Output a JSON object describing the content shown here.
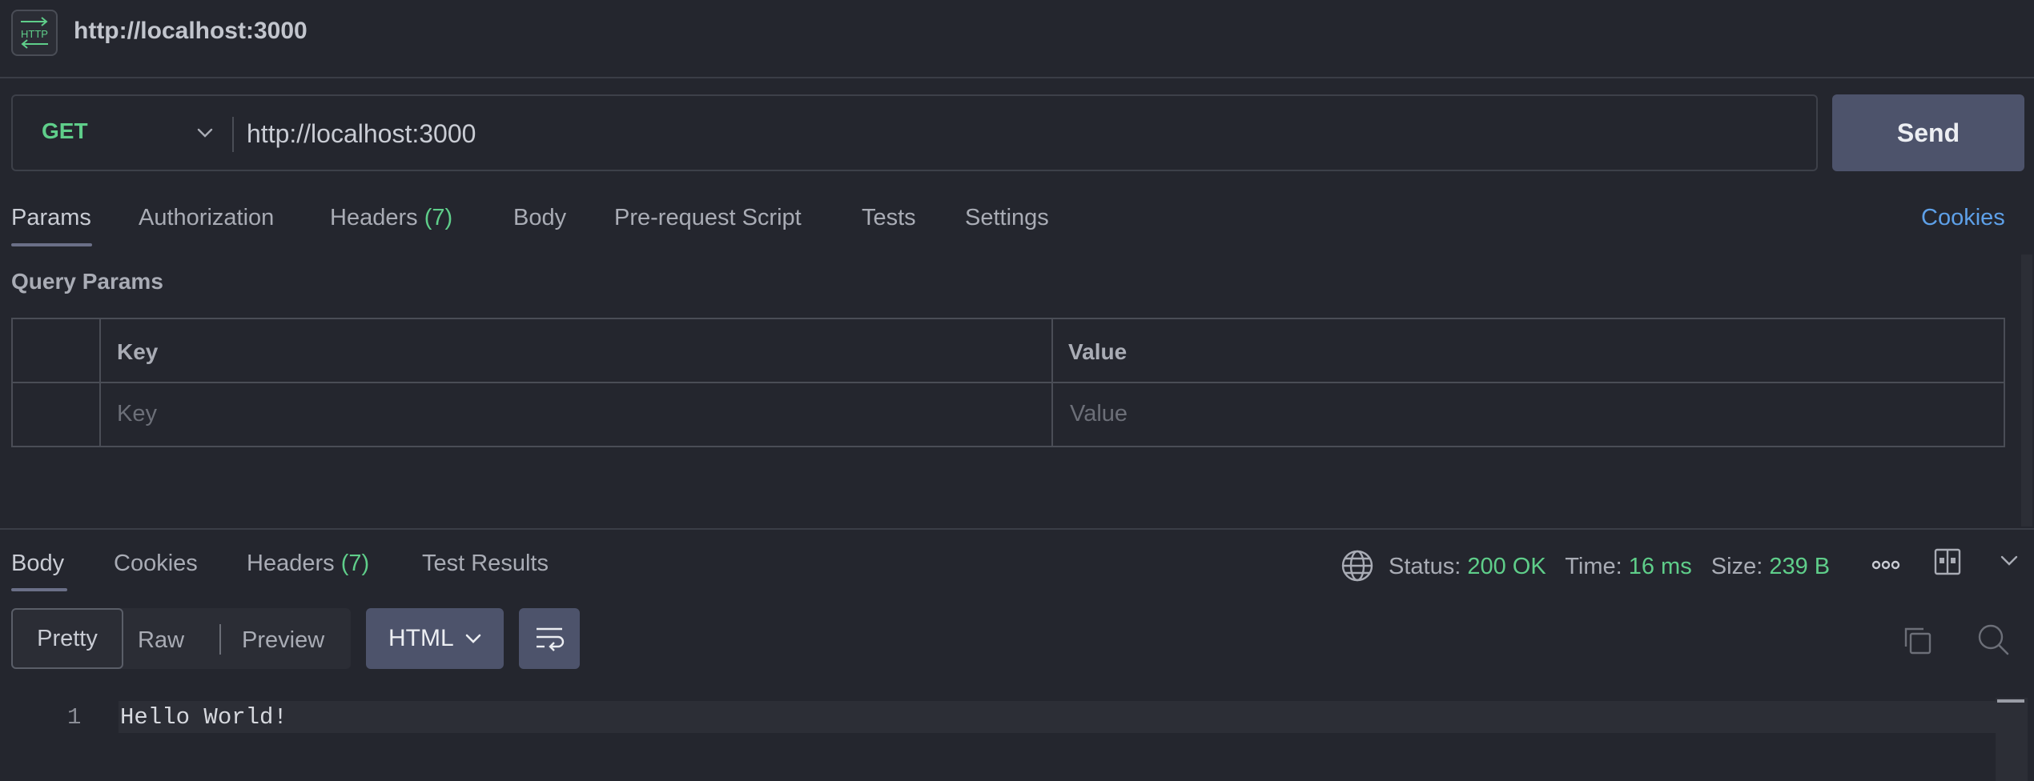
{
  "topbar": {
    "badge_text": "HTTP",
    "title": "http://localhost:3000"
  },
  "request": {
    "method": "GET",
    "url": "http://localhost:3000",
    "send_label": "Send"
  },
  "request_tabs": {
    "params": "Params",
    "authorization": "Authorization",
    "headers": "Headers",
    "headers_count": "(7)",
    "body": "Body",
    "prerequest": "Pre-request Script",
    "tests": "Tests",
    "settings": "Settings",
    "cookies": "Cookies"
  },
  "query_params": {
    "title": "Query Params",
    "columns": [
      "Key",
      "Value"
    ],
    "key_placeholder": "Key",
    "value_placeholder": "Value"
  },
  "response_tabs": {
    "body": "Body",
    "cookies": "Cookies",
    "headers": "Headers",
    "headers_count": "(7)",
    "test_results": "Test Results"
  },
  "response_meta": {
    "status_label": "Status:",
    "status_value": "200 OK",
    "time_label": "Time:",
    "time_value": "16 ms",
    "size_label": "Size:",
    "size_value": "239 B"
  },
  "view_controls": {
    "pretty": "Pretty",
    "raw": "Raw",
    "preview": "Preview",
    "format": "HTML"
  },
  "response_body": {
    "lines": [
      {
        "number": "1",
        "text": "Hello World!"
      }
    ]
  },
  "colors": {
    "background": "#24262e",
    "accent_green": "#5fce8a",
    "link_blue": "#5ea0e8",
    "button": "#4d536b"
  },
  "icons": [
    "http-icon",
    "chevron-down-icon",
    "globe-icon",
    "more-icon",
    "layout-icon",
    "copy-icon",
    "search-icon",
    "wrap-icon"
  ]
}
